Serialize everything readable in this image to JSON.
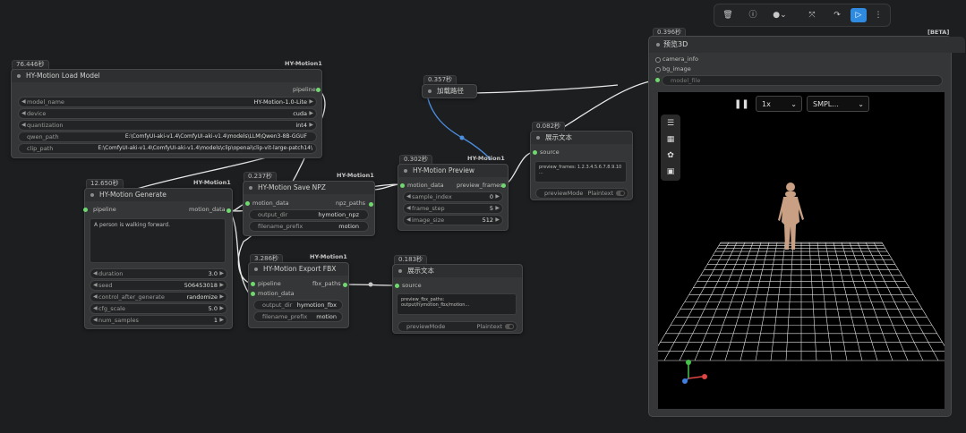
{
  "toolbar": {
    "delete_icon": "🗑",
    "info_icon": "ⓘ",
    "color_icon": "●",
    "color_caret": "⌄",
    "bypass_icon": "⤧",
    "redo_icon": "↷",
    "run_icon": "▷",
    "more_icon": "⋮"
  },
  "nodes": {
    "load_model": {
      "timing": "76.446秒",
      "badge": "HY-Motion1",
      "title": "HY-Motion Load Model",
      "output": "pipeline",
      "widgets": [
        {
          "label": "model_name",
          "value": "HY-Motion-1.0-Lite"
        },
        {
          "label": "device",
          "value": "cuda"
        },
        {
          "label": "quantization",
          "value": "int4"
        },
        {
          "label": "qwen_path",
          "value": "E:\\ComfyUI-aki-v1.4\\ComfyUI-aki-v1.4\\models\\LLM\\Qwen3-8B-GGUF"
        },
        {
          "label": "clip_path",
          "value": "E:\\ComfyUI-aki-v1.4\\ComfyUI-aki-v1.4\\models\\clip\\openai\\clip-vit-large-patch14\\"
        }
      ]
    },
    "generate": {
      "timing": "12.650秒",
      "badge": "HY-Motion1",
      "title": "HY-Motion Generate",
      "input": "pipeline",
      "output": "motion_data",
      "prompt": "A person is walking forward.",
      "widgets": [
        {
          "label": "duration",
          "value": "3.0"
        },
        {
          "label": "seed",
          "value": "506453018"
        },
        {
          "label": "control_after_generate",
          "value": "randomize"
        },
        {
          "label": "cfg_scale",
          "value": "5.0"
        },
        {
          "label": "num_samples",
          "value": "1"
        }
      ]
    },
    "save_npz": {
      "timing": "0.237秒",
      "badge": "HY-Motion1",
      "title": "HY-Motion Save NPZ",
      "input": "motion_data",
      "output": "npz_paths",
      "widgets": [
        {
          "label": "output_dir",
          "value": "hymotion_npz"
        },
        {
          "label": "filename_prefix",
          "value": "motion"
        }
      ]
    },
    "export_fbx": {
      "timing": "3.286秒",
      "badge": "HY-Motion1",
      "title": "HY-Motion Export FBX",
      "inputs": [
        "pipeline",
        "motion_data"
      ],
      "output": "fbx_paths",
      "widgets": [
        {
          "label": "output_dir",
          "value": "hymotion_fbx"
        },
        {
          "label": "filename_prefix",
          "value": "motion"
        }
      ]
    },
    "preview": {
      "timing": "0.302秒",
      "badge": "HY-Motion1",
      "title": "HY-Motion Preview",
      "input": "motion_data",
      "output": "preview_frames",
      "widgets": [
        {
          "label": "sample_index",
          "value": "0"
        },
        {
          "label": "frame_step",
          "value": "5"
        },
        {
          "label": "image_size",
          "value": "512"
        }
      ]
    },
    "load_path": {
      "timing": "0.357秒",
      "title": "加载路径"
    },
    "show_text": {
      "timing": "0.082秒",
      "title": "展示文本",
      "input": "source",
      "text": "preview_frames: 1.2.3.4.5.6.7.8.9.10\n...",
      "toggle_label": "previewMode",
      "toggle_value": "Plaintext"
    },
    "show_text2": {
      "timing": "0.183秒",
      "title": "展示文本",
      "input": "source",
      "text": "preview_fbx_paths: output/hymotion_fbx/motion...",
      "toggle_label": "previewMode",
      "toggle_value": "Plaintext"
    },
    "view3d": {
      "timing": "0.396秒",
      "badge": "[BETA]",
      "title": "预览3D",
      "inputs": [
        "camera_info",
        "bg_image"
      ],
      "model_file": "model_file",
      "speed": "1x",
      "animation": "SMPL..."
    }
  }
}
